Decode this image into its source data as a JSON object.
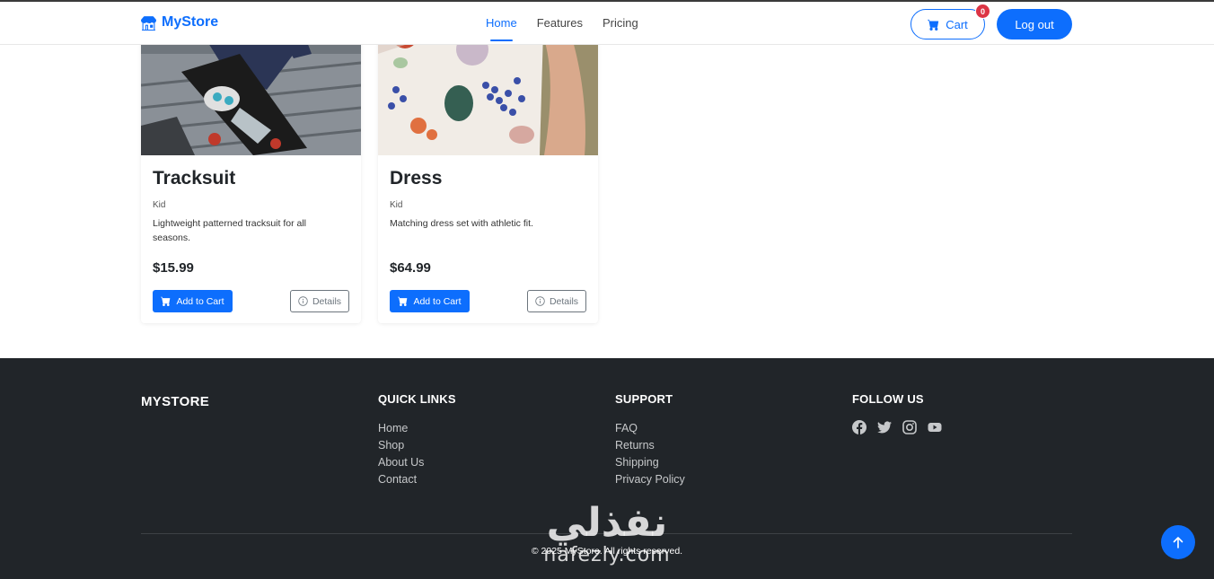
{
  "navbar": {
    "brand": "MyStore",
    "links": [
      {
        "label": "Home",
        "active": true
      },
      {
        "label": "Features",
        "active": false
      },
      {
        "label": "Pricing",
        "active": false
      }
    ],
    "cart_label": "Cart",
    "cart_count": "0",
    "logout_label": "Log out"
  },
  "products": [
    {
      "title": "Tracksuit",
      "category": "Kid",
      "description": "Lightweight patterned tracksuit for all seasons.",
      "price": "$15.99",
      "add_label": "Add to Cart",
      "details_label": "Details"
    },
    {
      "title": "Dress",
      "category": "Kid",
      "description": "Matching dress set with athletic fit.",
      "price": "$64.99",
      "add_label": "Add to Cart",
      "details_label": "Details"
    }
  ],
  "footer": {
    "brand": "MYSTORE",
    "quick_links": {
      "heading": "QUICK LINKS",
      "items": [
        "Home",
        "Shop",
        "About Us",
        "Contact"
      ]
    },
    "support": {
      "heading": "SUPPORT",
      "items": [
        "FAQ",
        "Returns",
        "Shipping",
        "Privacy Policy"
      ]
    },
    "follow": {
      "heading": "FOLLOW US",
      "icons": [
        "facebook-icon",
        "twitter-icon",
        "instagram-icon",
        "youtube-icon"
      ]
    },
    "copyright": "© 2025 MyStore. All rights reserved."
  },
  "watermark": {
    "arabic": "نفذلي",
    "latin": "nafezly.com"
  },
  "colors": {
    "primary": "#0d6efd",
    "footer_bg": "#212529",
    "badge": "#dc3545"
  }
}
